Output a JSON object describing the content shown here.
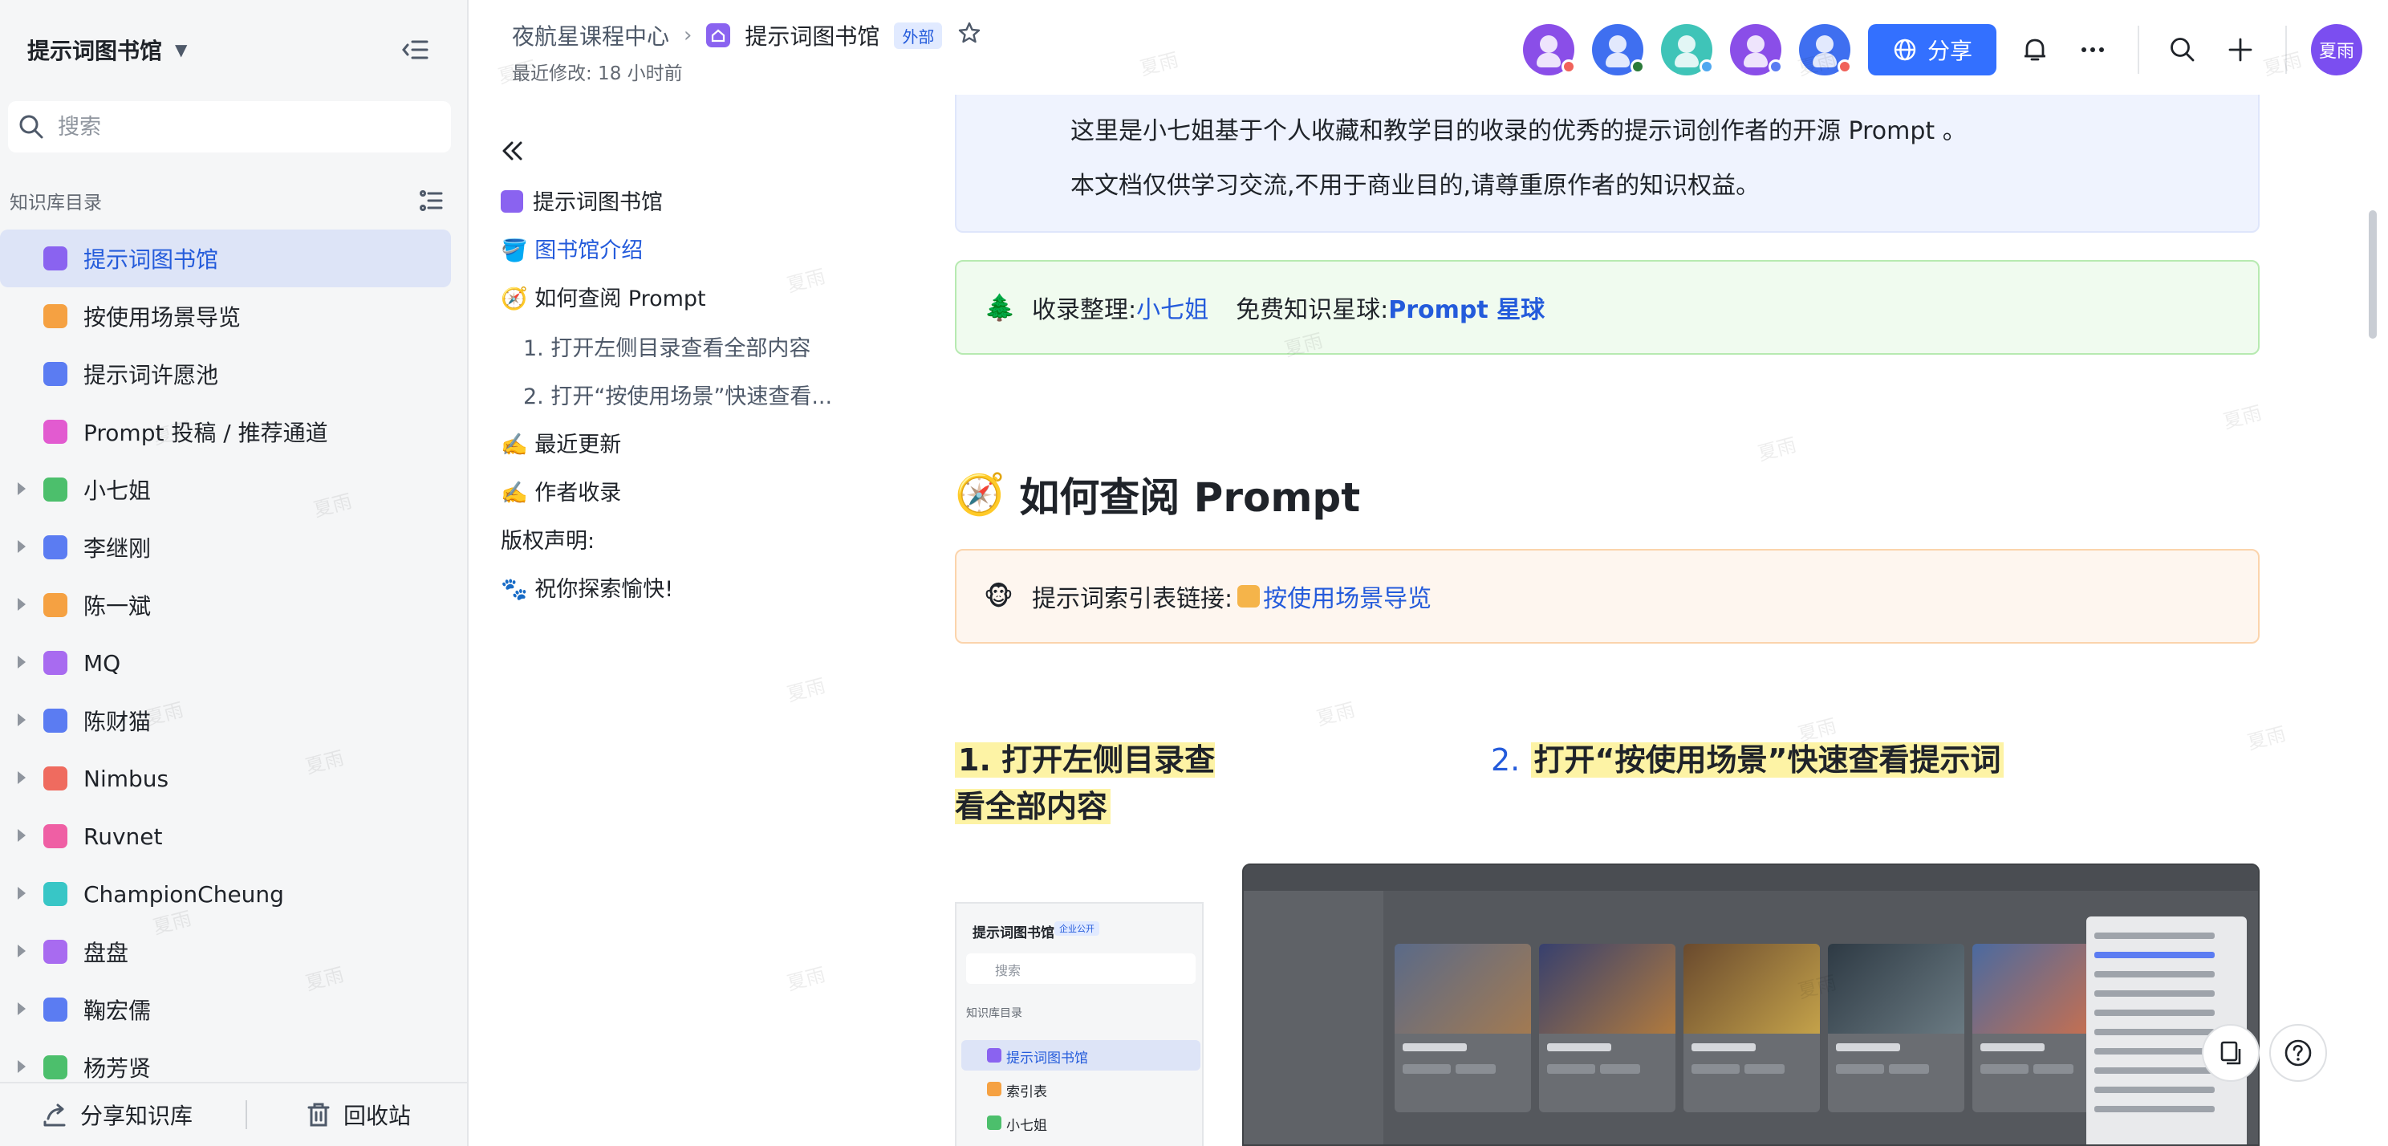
{
  "sidebar": {
    "title": "提示词图书馆",
    "search_placeholder": "搜索",
    "section_label": "知识库目录",
    "items": [
      {
        "label": "提示词图书馆",
        "color": "#8a63f0",
        "has_children": false,
        "active": true
      },
      {
        "label": "按使用场景导览",
        "color": "#f5a142",
        "has_children": false,
        "active": false
      },
      {
        "label": "提示词许愿池",
        "color": "#5b7cf2",
        "has_children": false,
        "active": false
      },
      {
        "label": "Prompt 投稿 / 推荐通道",
        "color": "#e25bd0",
        "has_children": false,
        "active": false
      },
      {
        "label": "小七姐",
        "color": "#4cbf6c",
        "has_children": true,
        "active": false
      },
      {
        "label": "李继刚",
        "color": "#5b7cf2",
        "has_children": true,
        "active": false
      },
      {
        "label": "陈一斌",
        "color": "#f5a142",
        "has_children": true,
        "active": false
      },
      {
        "label": "MQ",
        "color": "#a86bf0",
        "has_children": true,
        "active": false
      },
      {
        "label": "陈财猫",
        "color": "#5b7cf2",
        "has_children": true,
        "active": false
      },
      {
        "label": "Nimbus",
        "color": "#ef6b5f",
        "has_children": true,
        "active": false
      },
      {
        "label": "Ruvnet",
        "color": "#ef5fa4",
        "has_children": true,
        "active": false
      },
      {
        "label": "ChampionCheung",
        "color": "#38c6c6",
        "has_children": true,
        "active": false
      },
      {
        "label": "盘盘",
        "color": "#a86bf0",
        "has_children": true,
        "active": false
      },
      {
        "label": "鞠宏儒",
        "color": "#5b7cf2",
        "has_children": true,
        "active": false
      },
      {
        "label": "杨芳贤",
        "color": "#4cbf6c",
        "has_children": true,
        "active": false
      }
    ],
    "footer": {
      "share_label": "分享知识库",
      "trash_label": "回收站"
    }
  },
  "topbar": {
    "breadcrumb_root": "夜航星课程中心",
    "breadcrumb_current": "提示词图书馆",
    "external_tag": "外部",
    "last_modified": "最近修改: 18 小时前",
    "share_label": "分享",
    "user_avatar_text": "夏雨",
    "collaborators": [
      {
        "color": "#8a4ee8",
        "status": "#f0625a"
      },
      {
        "color": "#3f6ff0",
        "status": "#2b7a3a"
      },
      {
        "color": "#3fc4b8",
        "status": "#4fa8f0"
      },
      {
        "color": "#8a4ee8",
        "status": "#5b7cf2"
      },
      {
        "color": "#3f6ff0",
        "status": "#f0625a"
      }
    ]
  },
  "outline": {
    "items": [
      {
        "label": "提示词图书馆",
        "icon": "home-icon"
      },
      {
        "label": "🪣 图书馆介绍",
        "active": true
      },
      {
        "label": "🧭 如何查阅 Prompt"
      },
      {
        "label": "1. 打开左侧目录查看全部内容",
        "sub": true
      },
      {
        "label": "2. 打开“按使用场景”快速查看...",
        "sub": true
      },
      {
        "label": "✍️ 最近更新"
      },
      {
        "label": "✍️ 作者收录"
      },
      {
        "label": "版权声明:"
      },
      {
        "label": "🐾 祝你探索愉快!"
      }
    ]
  },
  "doc": {
    "intro_line1": "这里是小七姐基于个人收藏和教学目的收录的优秀的提示词创作者的开源 Prompt 。",
    "intro_line2": "本文档仅供学习交流,不用于商业目的,请尊重原作者的知识权益。",
    "collector_emoji": "🌲",
    "collector_label": "收录整理:",
    "collector_name": "小七姐",
    "planet_label": "免费知识星球:",
    "planet_name": "Prompt 星球",
    "h1_emoji": "🧭",
    "h1": "如何查阅 Prompt",
    "index_emoji": "🐵",
    "index_label": "提示词索引表链接:",
    "index_link": "按使用场景导览",
    "col1_title": "1. 打开左侧目录查看全部内容",
    "col2_num": "2.",
    "col2_title": "打开“按使用场景”快速查看提示词",
    "mini_shot": {
      "title": "提示词图书馆",
      "tag": "企业公开",
      "search": "搜索",
      "section": "知识库目录",
      "items": [
        "提示词图书馆",
        "索引表",
        "小七姐"
      ]
    }
  },
  "watermark": "夏雨"
}
